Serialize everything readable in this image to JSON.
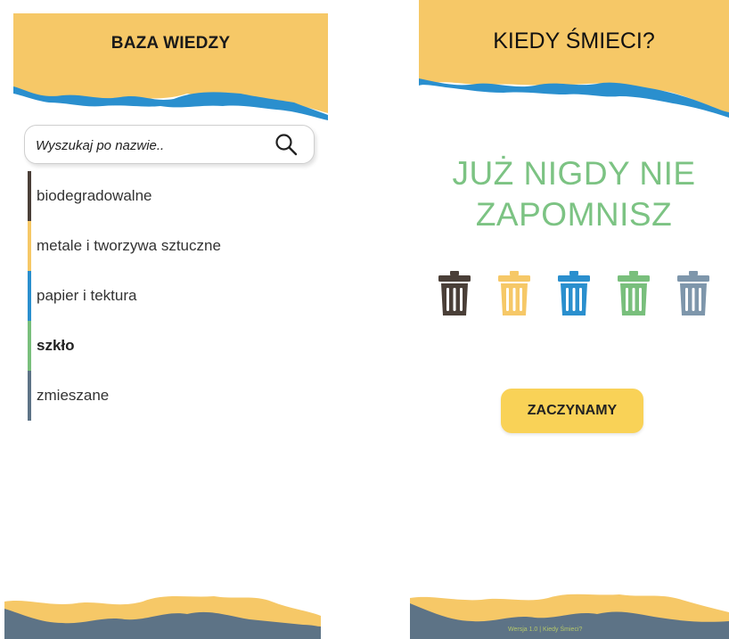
{
  "knowledge_base": {
    "title": "BAZA WIEDZY",
    "search": {
      "placeholder": "Wyszukaj po nazwie..",
      "icon": "search-icon"
    },
    "categories": [
      {
        "label": "biodegradowalne",
        "color": "#4a3f38",
        "bold": false
      },
      {
        "label": "metale i tworzywa sztuczne",
        "color": "#f6c867",
        "bold": false
      },
      {
        "label": "papier i tektura",
        "color": "#2a8fce",
        "bold": false
      },
      {
        "label": "szkło",
        "color": "#79bf7c",
        "bold": true
      },
      {
        "label": "zmieszane",
        "color": "#5d7386",
        "bold": false
      }
    ]
  },
  "welcome": {
    "title": "KIEDY ŚMIECI?",
    "headline_line1": "JUŻ NIGDY NIE",
    "headline_line2": "ZAPOMNISZ",
    "bins": [
      {
        "icon": "trash-bin-icon",
        "color": "#4a3f38"
      },
      {
        "icon": "trash-bin-icon",
        "color": "#f6c867"
      },
      {
        "icon": "trash-bin-icon",
        "color": "#2a8fce"
      },
      {
        "icon": "trash-bin-icon",
        "color": "#79bf7c"
      },
      {
        "icon": "trash-bin-icon",
        "color": "#7e96ab"
      }
    ],
    "start_label": "ZACZYNAMY",
    "footer_text": "Wersja 1.0 | Kiedy Śmieci?"
  },
  "theme": {
    "header_yellow": "#f6c867",
    "wave_blue": "#2a8fce",
    "footer_slate": "#5d7386",
    "accent_green": "#7cc383",
    "button_yellow": "#f9d257"
  }
}
